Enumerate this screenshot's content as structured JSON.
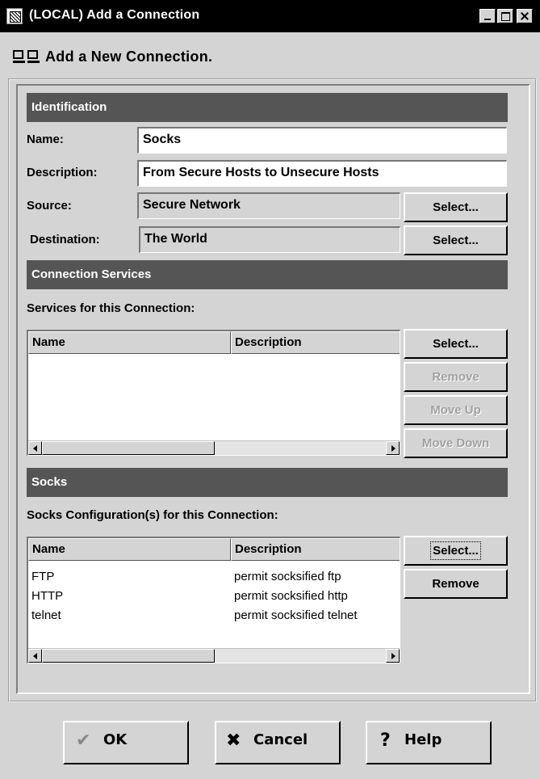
{
  "window": {
    "title": "(LOCAL) Add a Connection"
  },
  "header": {
    "title": "Add a New Connection."
  },
  "identification": {
    "section_title": "Identification",
    "name_label": "Name:",
    "name_value": "Socks",
    "description_label": "Description:",
    "description_value": "From Secure Hosts to Unsecure Hosts",
    "source_label": "Source:",
    "source_value": "Secure Network",
    "source_button": "Select...",
    "destination_label": "Destination:",
    "destination_value": "The World",
    "destination_button": "Select..."
  },
  "services": {
    "section_title": "Connection Services",
    "list_label": "Services for this Connection:",
    "columns": [
      "Name",
      "Description"
    ],
    "rows": [],
    "buttons": {
      "select": "Select...",
      "remove": "Remove",
      "move_up": "Move Up",
      "move_down": "Move Down"
    }
  },
  "socks": {
    "section_title": "Socks",
    "list_label": "Socks Configuration(s) for this Connection:",
    "columns": [
      "Name",
      "Description"
    ],
    "rows": [
      {
        "name": "FTP",
        "description": "permit socksified ftp"
      },
      {
        "name": "HTTP",
        "description": "permit socksified http"
      },
      {
        "name": "telnet",
        "description": "permit socksified telnet"
      }
    ],
    "buttons": {
      "select": "Select...",
      "remove": "Remove"
    }
  },
  "footer": {
    "ok": "OK",
    "cancel": "Cancel",
    "help": "Help"
  },
  "icons": {
    "ok": "checkmark-icon",
    "cancel": "x-icon",
    "help": "question-mark-icon"
  }
}
